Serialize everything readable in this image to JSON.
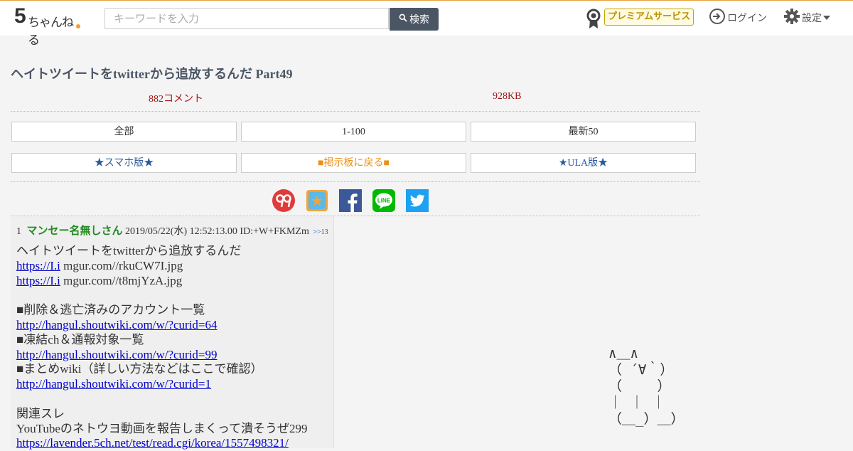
{
  "header": {
    "logo_text": "5ちゃんねる",
    "search_placeholder": "キーワードを入力",
    "search_button": "検索",
    "premium_label": "プレミアムサービス",
    "login_label": "ログイン",
    "settings_label": "設定"
  },
  "thread": {
    "title": "ヘイトツイートをtwitterから追放するんだ Part49",
    "comments": "882コメント",
    "size": "928KB"
  },
  "nav": {
    "all": "全部",
    "range": "1-100",
    "latest": "最新50",
    "smartphone": "★スマホ版★",
    "back_to_board": "■掲示板に戻る■",
    "ula": "★ULA版★"
  },
  "colors": {
    "accent": "#e8a23a",
    "name_green": "#228b22",
    "link_blue": "#0000cc",
    "stat_red": "#a31515"
  },
  "share_icons": [
    "5ch-99-icon",
    "bookmark-icon",
    "facebook-icon",
    "line-icon",
    "twitter-icon"
  ],
  "post": {
    "number": "1",
    "name": "マンセー名無しさん",
    "date": "2019/05/22(水) 12:52:13.00",
    "id": "ID:+W+FKMZm",
    "anchor": ">>13",
    "lines": {
      "l1": "ヘイトツイートをtwitterから追放するんだ",
      "link1": "https://I.i",
      "link1_rest": " mgur.com//rkuCW7I.jpg",
      "link2": "https://I.i",
      "link2_rest": " mgur.com//t8mjYzA.jpg",
      "l_deleted": "■削除＆逃亡済みのアカウント一覧",
      "url1": "http://hangul.shoutwiki.com/w/?curid=64",
      "l_frozen": "■凍結ch＆通報対象一覧",
      "url2": "http://hangul.shoutwiki.com/w/?curid=99",
      "l_wiki": "■まとめwiki（詳しい方法などはここで確認）",
      "url3": "http://hangul.shoutwiki.com/w/?curid=1",
      "l_related": "関連スレ",
      "l_youtube": "YouTubeのネトウヨ動画を報告しまくって潰そうぜ299",
      "url4": "https://lavender.5ch.net/test/read.cgi/korea/1557498321/"
    }
  },
  "ascii_art": "∧＿∧\n（ ´∀｀）\n（　　 ）\n｜ ｜ ｜\n（＿_）＿）"
}
